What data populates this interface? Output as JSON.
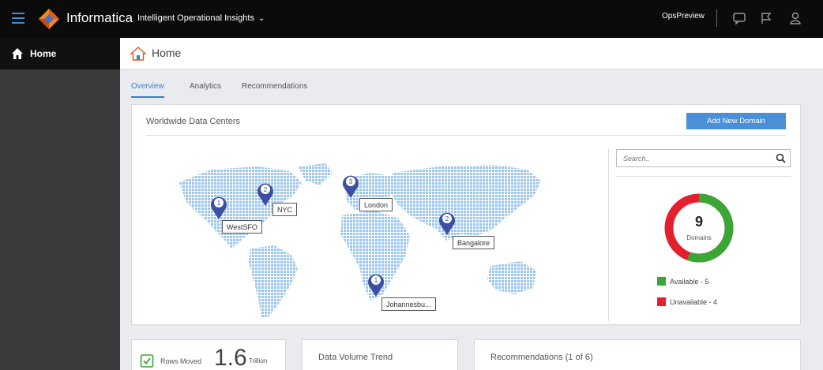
{
  "topbar": {
    "brand": "Informatica",
    "app_name": "Intelligent Operational Insights",
    "user": "OpsPreview",
    "icons": [
      "menu-icon",
      "informatica-logo",
      "chevron-down-icon",
      "chat-icon",
      "flag-icon",
      "user-icon"
    ]
  },
  "sidebar": {
    "items": [
      {
        "label": "Home",
        "icon": "home-icon"
      }
    ]
  },
  "page": {
    "title": "Home",
    "icon": "home-icon"
  },
  "tabs": [
    {
      "label": "Overview",
      "active": true
    },
    {
      "label": "Analytics",
      "active": false
    },
    {
      "label": "Recommendations",
      "active": false
    }
  ],
  "data_centers": {
    "title": "Worldwide Data Centers",
    "add_button": "Add New Domain",
    "locations": [
      {
        "name": "WestSFO",
        "count": "1"
      },
      {
        "name": "NYC",
        "count": "2"
      },
      {
        "name": "London",
        "count": "3"
      },
      {
        "name": "Bangalore",
        "count": "2"
      },
      {
        "name": "Johannesbu...",
        "count": "1"
      }
    ],
    "search_placeholder": "Search..",
    "domains": {
      "total": "9",
      "label": "Domains",
      "available": 5,
      "unavailable": 4,
      "available_label": "Available - 5",
      "unavailable_label": "Unavailable - 4"
    },
    "colors": {
      "available": "#3aa635",
      "unavailable": "#e5202e",
      "map": "#9cc6ee",
      "pin": "#3d4fa0"
    }
  },
  "bottom_cards": {
    "rows_moved": {
      "label": "Rows Moved",
      "value": "1.6",
      "unit": "Trillion"
    },
    "volume_trend": {
      "title": "Data Volume Trend"
    },
    "recommendations": {
      "title": "Recommendations (1 of 6)"
    }
  }
}
